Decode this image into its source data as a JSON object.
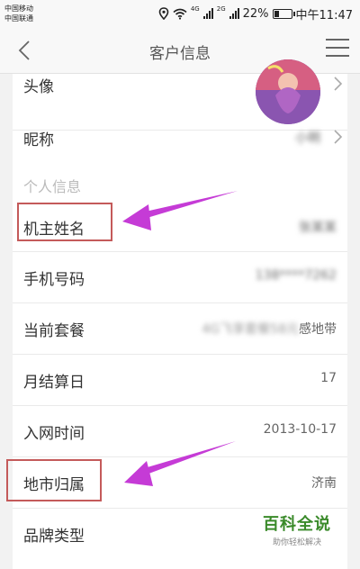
{
  "status_bar": {
    "carrier_1": "中国移动",
    "carrier_2": "中国联通",
    "battery": "22%",
    "time": "中午11:47",
    "net_1": "4G",
    "net_2": "2G"
  },
  "nav": {
    "title": "客户信息"
  },
  "rows": {
    "avatar_label": "头像",
    "nickname_label": "昵称",
    "nickname_value": "小明",
    "section_personal": "个人信息",
    "owner_name_label": "机主姓名",
    "owner_name_value": "张某某",
    "phone_label": "手机号码",
    "phone_value": "138****7262",
    "plan_label": "当前套餐",
    "plan_value_blurred": "4G飞享套餐58元",
    "plan_value_suffix": "感地带",
    "billing_day_label": "月结算日",
    "billing_day_value": "17",
    "join_date_label": "入网时间",
    "join_date_value": "2013-10-17",
    "region_label": "地市归属",
    "region_value": "济南",
    "brand_label": "品牌类型"
  },
  "watermark": {
    "title": "百科全说",
    "subtitle": "助你轻松解决"
  },
  "colors": {
    "annotation_arrow": "#c53bd6",
    "annotation_box": "#c45a5a",
    "watermark_green": "#3a8a2a"
  }
}
